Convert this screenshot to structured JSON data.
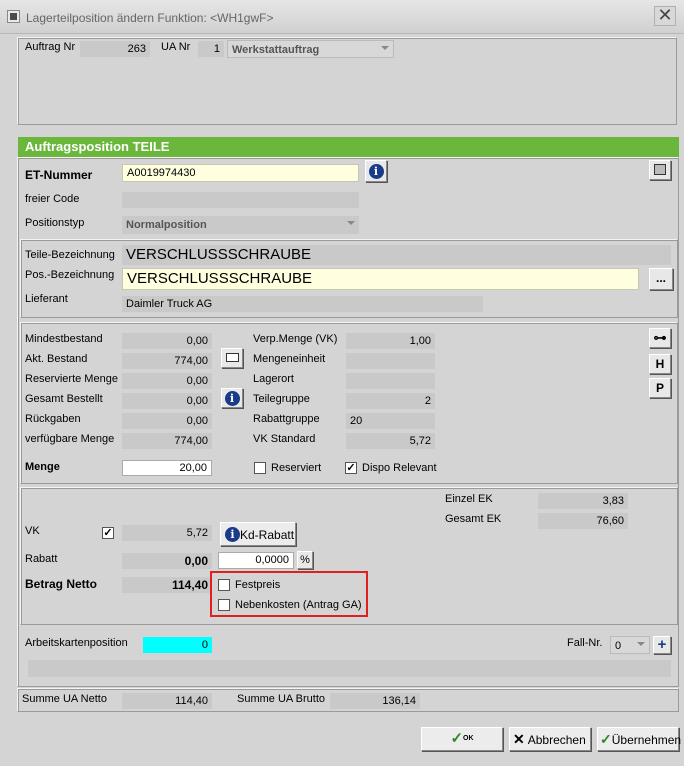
{
  "window": {
    "title": "Lagerteilposition ändern    Funktion: <WH1gwF>",
    "close": "✕"
  },
  "header": {
    "auftrag_nr_label": "Auftrag Nr",
    "auftrag_nr": "263",
    "ua_nr_label": "UA Nr",
    "ua_nr": "1",
    "auftragsart": "Werkstattauftrag"
  },
  "section_title": "Auftragsposition  TEILE",
  "position": {
    "et_nummer_label": "ET-Nummer",
    "et_nummer": "A0019974430",
    "freier_code_label": "freier Code",
    "freier_code": "",
    "positionstyp_label": "Positionstyp",
    "positionstyp": "Normalposition"
  },
  "teil": {
    "bezeichnung_label": "Teile-Bezeichnung",
    "bezeichnung": "VERSCHLUSSSCHRAUBE",
    "pos_bezeichnung_label": "Pos.-Bezeichnung",
    "pos_bezeichnung": "VERSCHLUSSSCHRAUBE",
    "lieferant_label": "Lieferant",
    "lieferant": "Daimler Truck AG",
    "more_btn": "..."
  },
  "bestand": {
    "mindestbestand_label": "Mindestbestand",
    "mindestbestand": "0,00",
    "akt_bestand_label": "Akt. Bestand",
    "akt_bestand": "774,00",
    "reservierte_menge_label": "Reservierte Menge",
    "reservierte_menge": "0,00",
    "gesamt_bestellt_label": "Gesamt Bestellt",
    "gesamt_bestellt": "0,00",
    "rueckgaben_label": "Rückgaben",
    "rueckgaben": "0,00",
    "verfuegbare_menge_label": "verfügbare Menge",
    "verfuegbare_menge": "774,00",
    "verp_menge_label": "Verp.Menge (VK)",
    "verp_menge": "1,00",
    "mengeneinheit_label": "Mengeneinheit",
    "mengeneinheit": "",
    "lagerort_label": "Lagerort",
    "lagerort": "",
    "teilegruppe_label": "Teilegruppe",
    "teilegruppe": "2",
    "rabattgruppe_label": "Rabattgruppe",
    "rabattgruppe": "20",
    "vk_standard_label": "VK Standard",
    "vk_standard": "5,72",
    "menge_label": "Menge",
    "menge": "20,00",
    "reserviert_label": "Reserviert",
    "reserviert_checked": false,
    "dispo_label": "Dispo Relevant",
    "dispo_checked": true,
    "side_btn_h": "H",
    "side_btn_p": "P"
  },
  "preis": {
    "einzel_ek_label": "Einzel EK",
    "einzel_ek": "3,83",
    "gesamt_ek_label": "Gesamt EK",
    "gesamt_ek": "76,60",
    "vk_label": "VK",
    "vk_checked": true,
    "vk": "5,72",
    "kd_rabatt_btn": "Kd-Rabatt",
    "rabatt_label": "Rabatt",
    "rabatt_betrag": "0,00",
    "rabatt_prozent": "0,0000",
    "prozent_btn": "%",
    "betrag_netto_label": "Betrag Netto",
    "betrag_netto": "114,40",
    "festpreis_label": "Festpreis",
    "festpreis_checked": false,
    "nebenkosten_label": "Nebenkosten (Antrag GA)",
    "nebenkosten_checked": false
  },
  "arbeitskarte": {
    "label": "Arbeitskartenposition",
    "value": "0",
    "fall_nr_label": "Fall-Nr.",
    "fall_nr": "0",
    "add_btn": "+"
  },
  "summen": {
    "netto_label": "Summe UA Netto",
    "netto": "114,40",
    "brutto_label": "Summe UA Brutto",
    "brutto": "136,14"
  },
  "buttons": {
    "ok": "OK",
    "abbrechen": "Abbrechen",
    "uebernehmen": "Übernehmen"
  },
  "colors": {
    "section_header": "#6ab73c",
    "highlight_box": "#e02020",
    "arbeitskarte_field": "#00ffff"
  },
  "icons": [
    "window-icon",
    "info-icon",
    "calculator-icon",
    "key-icon",
    "note-icon",
    "check-icon",
    "x-icon",
    "checkmark-icon"
  ]
}
